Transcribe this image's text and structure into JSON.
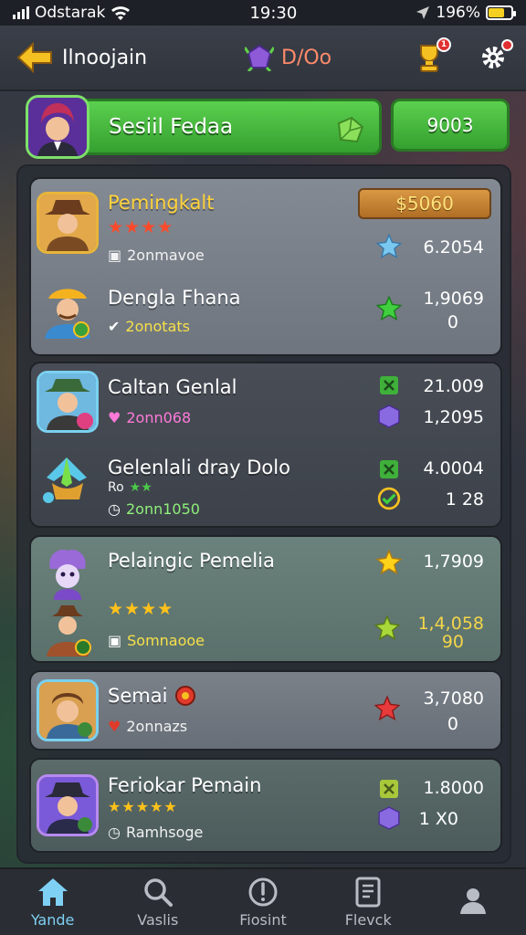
{
  "status_bar": {
    "carrier": "Odstarak",
    "time": "19:30",
    "battery": "196%"
  },
  "header": {
    "title": "Ilnoojain",
    "coins": "D/Oo"
  },
  "banner": {
    "player_name": "Sesiil Fedaa",
    "score": "9003"
  },
  "rows": [
    {
      "name": "Pemingkalt",
      "stars": "★★★★",
      "sub": "2onmavoe",
      "pill": "$5060",
      "value": "6.2054"
    },
    {
      "name": "Dengla Fhana",
      "sub": "2onotats",
      "value": "1,9069",
      "value2": "0"
    },
    {
      "name": "Caltan Genlal",
      "sub": "2onn068",
      "value": "21.009",
      "value2": "1,2095"
    },
    {
      "name": "Gelenlali dray Dolo",
      "sub_top": "Ro",
      "sub": "2onn1050",
      "value": "4.0004",
      "value2": "1 28"
    },
    {
      "name": "Pelaingic Pemelia",
      "value": "1,7909"
    },
    {
      "stars": "★★★★",
      "sub": "Somnaooe",
      "value": "1,4,058",
      "value2": "90"
    },
    {
      "name": "Semai",
      "sub": "2onnazs",
      "value": "3,7080",
      "value2": "0"
    },
    {
      "name": "Feriokar Pemain",
      "stars": "★★★★★",
      "sub": "Ramhsoge",
      "value": "1.8000",
      "value2": "1 X0"
    }
  ],
  "nav": [
    {
      "label": "Yande",
      "icon": "home-icon"
    },
    {
      "label": "Vaslis",
      "icon": "search-icon"
    },
    {
      "label": "Fiosint",
      "icon": "alert-icon"
    },
    {
      "label": "Flevck",
      "icon": "document-icon"
    },
    {
      "label": "",
      "icon": "profile-icon"
    }
  ]
}
